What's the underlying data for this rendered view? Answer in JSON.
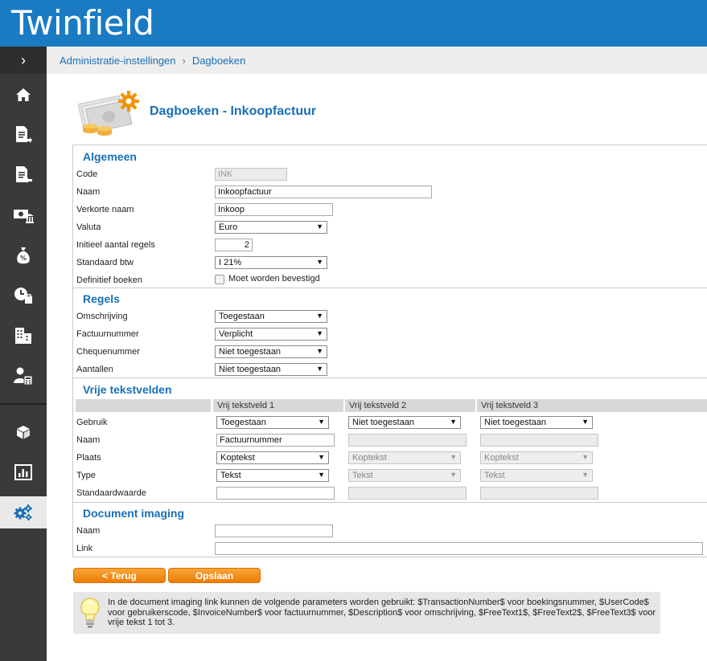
{
  "app": {
    "brand": "Twinfield"
  },
  "sidebar": {
    "toggle": "›",
    "items": [
      {
        "name": "home-icon"
      },
      {
        "name": "sales-invoice-icon"
      },
      {
        "name": "purchase-invoice-icon"
      },
      {
        "name": "bank-icon"
      },
      {
        "name": "money-bag-icon"
      },
      {
        "name": "time-expense-icon"
      },
      {
        "name": "company-icon"
      },
      {
        "name": "user-calculator-icon"
      },
      {
        "name": "cube-icon"
      },
      {
        "name": "report-chart-icon"
      },
      {
        "name": "settings-gears-icon",
        "active": true
      }
    ]
  },
  "breadcrumb": {
    "item1": "Administratie-instellingen",
    "separator": "›",
    "item2": "Dagboeken"
  },
  "page": {
    "title": "Dagboeken - Inkoopfactuur"
  },
  "algemeen": {
    "title": "Algemeen",
    "code_label": "Code",
    "code_value": "INK",
    "naam_label": "Naam",
    "naam_value": "Inkoopfactuur",
    "verkorte_label": "Verkorte naam",
    "verkorte_value": "Inkoop",
    "valuta_label": "Valuta",
    "valuta_value": "Euro",
    "regels_label": "Initieel aantal regels",
    "regels_value": "2",
    "btw_label": "Standaard btw",
    "btw_value": "I 21%",
    "definitief_label": "Definitief boeken",
    "definitief_checkbox_label": "Moet worden bevestigd"
  },
  "regels": {
    "title": "Regels",
    "omschrijving_label": "Omschrijving",
    "omschrijving_value": "Toegestaan",
    "factuurnummer_label": "Factuurnummer",
    "factuurnummer_value": "Verplicht",
    "chequenummer_label": "Chequenummer",
    "chequenummer_value": "Niet toegestaan",
    "aantallen_label": "Aantallen",
    "aantallen_value": "Niet toegestaan"
  },
  "vrije": {
    "title": "Vrije tekstvelden",
    "columns": [
      "Vrij tekstveld 1",
      "Vrij tekstveld 2",
      "Vrij tekstveld 3"
    ],
    "gebruik_label": "Gebruik",
    "naam_label": "Naam",
    "plaats_label": "Plaats",
    "type_label": "Type",
    "standaard_label": "Standaardwaarde",
    "col1": {
      "gebruik": "Toegestaan",
      "naam": "Factuurnummer",
      "plaats": "Koptekst",
      "type": "Tekst"
    },
    "col2": {
      "gebruik": "Niet toegestaan",
      "plaats": "Koptekst",
      "type": "Tekst"
    },
    "col3": {
      "gebruik": "Niet toegestaan",
      "plaats": "Koptekst",
      "type": "Tekst"
    }
  },
  "document": {
    "title": "Document imaging",
    "naam_label": "Naam",
    "link_label": "Link"
  },
  "buttons": {
    "back": "< Terug",
    "save": "Opslaan"
  },
  "info": {
    "text": "In de document imaging link kunnen de volgende parameters worden gebruikt: $TransactionNumber$ voor boekingsnummer, $UserCode$ voor gebruikerscode, $InvoiceNumber$ voor factuurnummer, $Description$ voor omschrijving, $FreeText1$, $FreeText2$, $FreeText3$ voor vrije tekst 1 tot 3."
  },
  "colors": {
    "brand_blue": "#1a7bc3",
    "link_blue": "#1a6fb5",
    "sidebar": "#3a3a3a",
    "button_orange": "#ef7d00"
  }
}
